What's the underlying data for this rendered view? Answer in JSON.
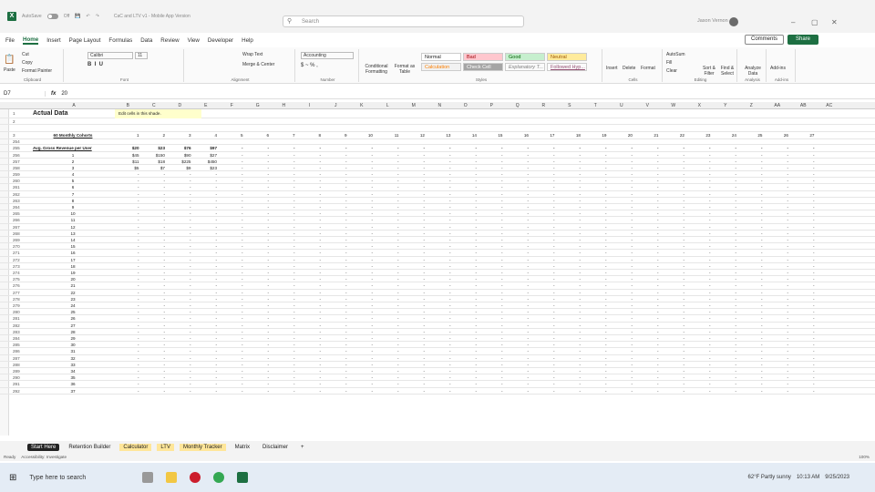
{
  "window": {
    "autosave_label": "AutoSave",
    "autosave_state": "Off",
    "filename": "CaC and LTV v1 - Mobile App Version",
    "search_placeholder": "Search",
    "user_name": "Jason Vernon"
  },
  "menu_tabs": [
    "File",
    "Home",
    "Insert",
    "Page Layout",
    "Formulas",
    "Data",
    "Review",
    "View",
    "Developer",
    "Help"
  ],
  "buttons": {
    "comments": "Comments",
    "share": "Share"
  },
  "ribbon": {
    "clipboard": {
      "paste": "Paste",
      "cut": "Cut",
      "copy": "Copy",
      "format_painter": "Format Painter",
      "label": "Clipboard"
    },
    "font": {
      "name": "Calibri",
      "size": "11",
      "label": "Font"
    },
    "alignment": {
      "wrap": "Wrap Text",
      "merge": "Merge & Center",
      "label": "Alignment"
    },
    "number": {
      "format": "Accounting",
      "label": "Number"
    },
    "styles": {
      "conditional": "Conditional Formatting",
      "format_table": "Format as Table",
      "normal": "Normal",
      "bad": "Bad",
      "good": "Good",
      "neutral": "Neutral",
      "calculation": "Calculation",
      "check_cell": "Check Cell",
      "explanatory": "Explanatory T...",
      "followed": "Followed Hyp...",
      "label": "Styles"
    },
    "cells": {
      "insert": "Insert",
      "delete": "Delete",
      "format": "Format",
      "label": "Cells"
    },
    "editing": {
      "autosum": "AutoSum",
      "fill": "Fill",
      "clear": "Clear",
      "sort": "Sort & Filter",
      "find": "Find & Select",
      "label": "Editing"
    },
    "analysis": {
      "analyze": "Analyze Data",
      "label": "Analysis"
    },
    "addins": {
      "addins": "Add-ins",
      "label": "Add-ins"
    }
  },
  "formula_bar": {
    "name_box": "D7",
    "value": "20"
  },
  "column_headers": [
    "A",
    "B",
    "C",
    "D",
    "E",
    "F",
    "G",
    "H",
    "I",
    "J",
    "K",
    "L",
    "M",
    "N",
    "O",
    "P",
    "Q",
    "R",
    "S",
    "T",
    "U",
    "V",
    "W",
    "X",
    "Y",
    "Z",
    "AA",
    "AB",
    "AC"
  ],
  "sheet": {
    "title": "Actual Data",
    "note": "Edit cells in this shade.",
    "cohorts_label": "60 Monthly Cohorts",
    "cohort_numbers": [
      "1",
      "2",
      "3",
      "4",
      "5",
      "6",
      "7",
      "8",
      "9",
      "10",
      "11",
      "12",
      "13",
      "14",
      "15",
      "16",
      "17",
      "18",
      "19",
      "20",
      "21",
      "22",
      "23",
      "24",
      "25",
      "26",
      "27"
    ],
    "avg_rev_label": "Avg. Gross Revenue per User",
    "avg_rev_values": [
      "$20",
      "$23",
      "$76",
      "$97"
    ],
    "dash": "-",
    "data_rows": [
      {
        "row": "256",
        "label": "1",
        "vals": [
          "$45",
          "$150",
          "$90",
          "$27"
        ]
      },
      {
        "row": "257",
        "label": "2",
        "vals": [
          "$11",
          "$18",
          "$225",
          "$450"
        ]
      },
      {
        "row": "258",
        "label": "3",
        "vals": [
          "$5",
          "$7",
          "$9",
          "$23"
        ]
      }
    ],
    "first_row_numbers": [
      "1",
      "2",
      "3",
      "254",
      "255"
    ],
    "empty_rows_start": 259,
    "empty_labels_start": 4,
    "empty_rows_count": 34
  },
  "sheet_tabs": [
    "Start Here",
    "Retention Builder",
    "Calculator",
    "LTV",
    "Monthly Tracker",
    "Matrix",
    "Disclaimer"
  ],
  "status": {
    "ready": "Ready",
    "accessibility": "Accessibility: Investigate",
    "zoom": "100%"
  },
  "taskbar": {
    "search": "Type here to search",
    "weather": "62°F Partly sunny",
    "time": "10:13 AM",
    "date": "9/25/2023"
  }
}
